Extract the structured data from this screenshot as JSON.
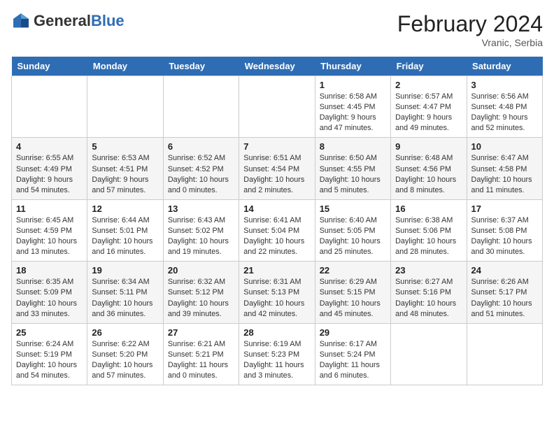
{
  "header": {
    "logo_general": "General",
    "logo_blue": "Blue",
    "month_year": "February 2024",
    "location": "Vranic, Serbia"
  },
  "days_of_week": [
    "Sunday",
    "Monday",
    "Tuesday",
    "Wednesday",
    "Thursday",
    "Friday",
    "Saturday"
  ],
  "weeks": [
    [
      {
        "day": "",
        "info": ""
      },
      {
        "day": "",
        "info": ""
      },
      {
        "day": "",
        "info": ""
      },
      {
        "day": "",
        "info": ""
      },
      {
        "day": "1",
        "info": "Sunrise: 6:58 AM\nSunset: 4:45 PM\nDaylight: 9 hours and 47 minutes."
      },
      {
        "day": "2",
        "info": "Sunrise: 6:57 AM\nSunset: 4:47 PM\nDaylight: 9 hours and 49 minutes."
      },
      {
        "day": "3",
        "info": "Sunrise: 6:56 AM\nSunset: 4:48 PM\nDaylight: 9 hours and 52 minutes."
      }
    ],
    [
      {
        "day": "4",
        "info": "Sunrise: 6:55 AM\nSunset: 4:49 PM\nDaylight: 9 hours and 54 minutes."
      },
      {
        "day": "5",
        "info": "Sunrise: 6:53 AM\nSunset: 4:51 PM\nDaylight: 9 hours and 57 minutes."
      },
      {
        "day": "6",
        "info": "Sunrise: 6:52 AM\nSunset: 4:52 PM\nDaylight: 10 hours and 0 minutes."
      },
      {
        "day": "7",
        "info": "Sunrise: 6:51 AM\nSunset: 4:54 PM\nDaylight: 10 hours and 2 minutes."
      },
      {
        "day": "8",
        "info": "Sunrise: 6:50 AM\nSunset: 4:55 PM\nDaylight: 10 hours and 5 minutes."
      },
      {
        "day": "9",
        "info": "Sunrise: 6:48 AM\nSunset: 4:56 PM\nDaylight: 10 hours and 8 minutes."
      },
      {
        "day": "10",
        "info": "Sunrise: 6:47 AM\nSunset: 4:58 PM\nDaylight: 10 hours and 11 minutes."
      }
    ],
    [
      {
        "day": "11",
        "info": "Sunrise: 6:45 AM\nSunset: 4:59 PM\nDaylight: 10 hours and 13 minutes."
      },
      {
        "day": "12",
        "info": "Sunrise: 6:44 AM\nSunset: 5:01 PM\nDaylight: 10 hours and 16 minutes."
      },
      {
        "day": "13",
        "info": "Sunrise: 6:43 AM\nSunset: 5:02 PM\nDaylight: 10 hours and 19 minutes."
      },
      {
        "day": "14",
        "info": "Sunrise: 6:41 AM\nSunset: 5:04 PM\nDaylight: 10 hours and 22 minutes."
      },
      {
        "day": "15",
        "info": "Sunrise: 6:40 AM\nSunset: 5:05 PM\nDaylight: 10 hours and 25 minutes."
      },
      {
        "day": "16",
        "info": "Sunrise: 6:38 AM\nSunset: 5:06 PM\nDaylight: 10 hours and 28 minutes."
      },
      {
        "day": "17",
        "info": "Sunrise: 6:37 AM\nSunset: 5:08 PM\nDaylight: 10 hours and 30 minutes."
      }
    ],
    [
      {
        "day": "18",
        "info": "Sunrise: 6:35 AM\nSunset: 5:09 PM\nDaylight: 10 hours and 33 minutes."
      },
      {
        "day": "19",
        "info": "Sunrise: 6:34 AM\nSunset: 5:11 PM\nDaylight: 10 hours and 36 minutes."
      },
      {
        "day": "20",
        "info": "Sunrise: 6:32 AM\nSunset: 5:12 PM\nDaylight: 10 hours and 39 minutes."
      },
      {
        "day": "21",
        "info": "Sunrise: 6:31 AM\nSunset: 5:13 PM\nDaylight: 10 hours and 42 minutes."
      },
      {
        "day": "22",
        "info": "Sunrise: 6:29 AM\nSunset: 5:15 PM\nDaylight: 10 hours and 45 minutes."
      },
      {
        "day": "23",
        "info": "Sunrise: 6:27 AM\nSunset: 5:16 PM\nDaylight: 10 hours and 48 minutes."
      },
      {
        "day": "24",
        "info": "Sunrise: 6:26 AM\nSunset: 5:17 PM\nDaylight: 10 hours and 51 minutes."
      }
    ],
    [
      {
        "day": "25",
        "info": "Sunrise: 6:24 AM\nSunset: 5:19 PM\nDaylight: 10 hours and 54 minutes."
      },
      {
        "day": "26",
        "info": "Sunrise: 6:22 AM\nSunset: 5:20 PM\nDaylight: 10 hours and 57 minutes."
      },
      {
        "day": "27",
        "info": "Sunrise: 6:21 AM\nSunset: 5:21 PM\nDaylight: 11 hours and 0 minutes."
      },
      {
        "day": "28",
        "info": "Sunrise: 6:19 AM\nSunset: 5:23 PM\nDaylight: 11 hours and 3 minutes."
      },
      {
        "day": "29",
        "info": "Sunrise: 6:17 AM\nSunset: 5:24 PM\nDaylight: 11 hours and 6 minutes."
      },
      {
        "day": "",
        "info": ""
      },
      {
        "day": "",
        "info": ""
      }
    ]
  ]
}
